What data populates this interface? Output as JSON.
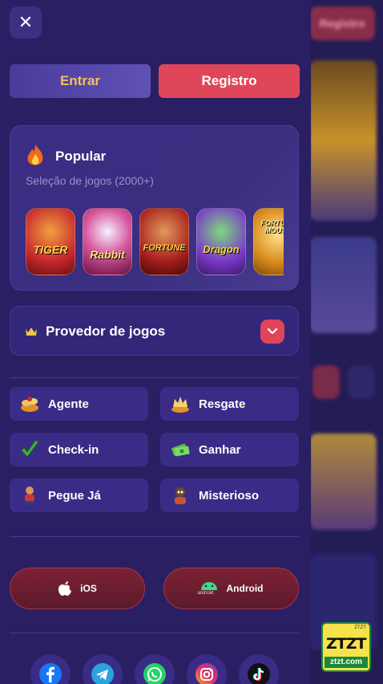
{
  "background": {
    "top_button_label": "Registro"
  },
  "drawer": {
    "close_label": "✕",
    "auth": {
      "login_label": "Entrar",
      "register_label": "Registro"
    },
    "popular": {
      "title": "Popular",
      "subtitle": "Seleção de jogos (2000+)",
      "games": [
        {
          "name": "Fortune Tiger",
          "label": "TIGER",
          "bg": "#c8282e",
          "fg": "#ffd34a"
        },
        {
          "name": "Fortune Rabbit",
          "label": "Rabbit",
          "bg": "#b61f52",
          "fg": "#ffe072"
        },
        {
          "name": "Fortune Ox",
          "label": "FORTUNE",
          "bg": "#a81e1e",
          "fg": "#ffcf3f"
        },
        {
          "name": "Fortune Dragon",
          "label": "Dragon",
          "bg": "#7a3ac8",
          "fg": "#ffd54a"
        },
        {
          "name": "Fortune Mouse",
          "label": "FORTUNE MOUSE",
          "bg": "#d88a1a",
          "fg": "#fff0a0"
        }
      ]
    },
    "provider": {
      "label": "Provedor de jogos"
    },
    "menu": [
      {
        "key": "agente",
        "label": "Agente",
        "icon": "coins-pile-icon"
      },
      {
        "key": "resgate",
        "label": "Resgate",
        "icon": "gold-crown-icon"
      },
      {
        "key": "checkin",
        "label": "Check-in",
        "icon": "checkmark-icon"
      },
      {
        "key": "ganhar",
        "label": "Ganhar",
        "icon": "money-icon"
      },
      {
        "key": "pegue",
        "label": "Pegue Já",
        "icon": "character-icon"
      },
      {
        "key": "misterioso",
        "label": "Misterioso",
        "icon": "mystery-character-icon"
      }
    ],
    "apps": {
      "ios_label": "iOS",
      "android_label": "Android",
      "android_icon_text": "android"
    },
    "social": [
      {
        "name": "facebook",
        "color": "#1877f2"
      },
      {
        "name": "telegram",
        "color": "#2aa3e0"
      },
      {
        "name": "whatsapp",
        "color": "#25d366"
      },
      {
        "name": "instagram",
        "color": "#e1306c"
      },
      {
        "name": "tiktok",
        "color": "#111111"
      }
    ]
  },
  "badge": {
    "main": "ZTZT",
    "sub": "ztzt.com",
    "tiny": "ZTZT"
  },
  "colors": {
    "drawer_bg": "#2a1f63",
    "accent_red": "#e0465a",
    "accent_gold": "#f3c25a"
  }
}
